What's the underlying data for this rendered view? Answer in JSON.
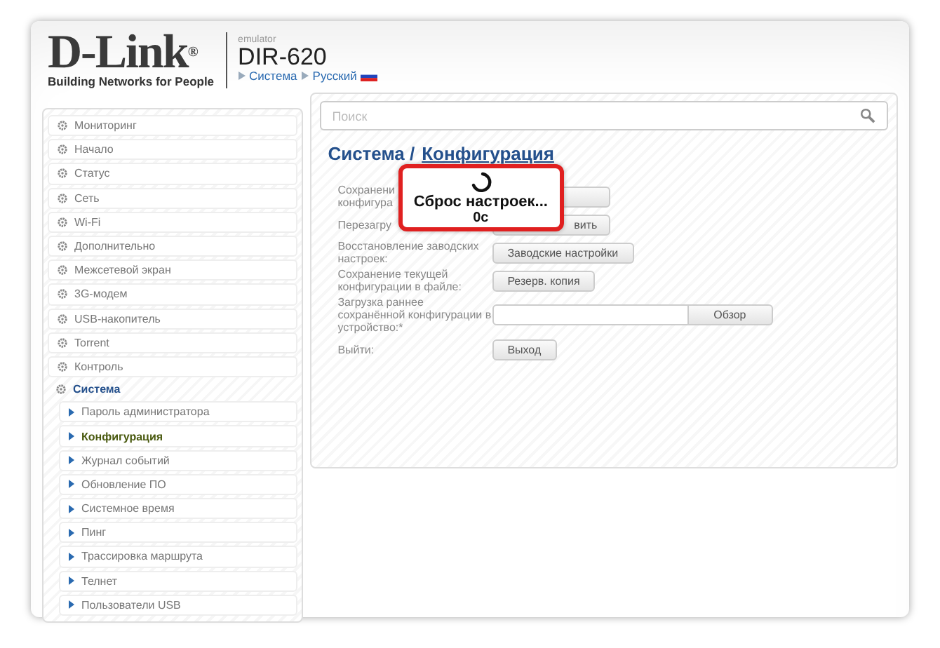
{
  "header": {
    "logo": "D-Link",
    "logo_trademark": "®",
    "tagline": "Building Networks for People",
    "emulator": "emulator",
    "model": "DIR-620",
    "breadcrumb": [
      {
        "label": "Система"
      },
      {
        "label": "Русский"
      }
    ]
  },
  "sidebar": {
    "items": [
      {
        "label": "Мониторинг",
        "expanded": false
      },
      {
        "label": "Начало",
        "expanded": false
      },
      {
        "label": "Статус",
        "expanded": false
      },
      {
        "label": "Сеть",
        "expanded": false
      },
      {
        "label": "Wi-Fi",
        "expanded": false
      },
      {
        "label": "Дополнительно",
        "expanded": false
      },
      {
        "label": "Межсетевой экран",
        "expanded": false
      },
      {
        "label": "3G-модем",
        "expanded": false
      },
      {
        "label": "USB-накопитель",
        "expanded": false
      },
      {
        "label": "Torrent",
        "expanded": false
      },
      {
        "label": "Контроль",
        "expanded": false
      },
      {
        "label": "Система",
        "expanded": true,
        "children": [
          {
            "label": "Пароль администратора",
            "selected": false
          },
          {
            "label": "Конфигурация",
            "selected": true
          },
          {
            "label": "Журнал событий",
            "selected": false
          },
          {
            "label": "Обновление ПО",
            "selected": false
          },
          {
            "label": "Системное время",
            "selected": false
          },
          {
            "label": "Пинг",
            "selected": false
          },
          {
            "label": "Трассировка маршрута",
            "selected": false
          },
          {
            "label": "Телнет",
            "selected": false
          },
          {
            "label": "Пользователи USB",
            "selected": false
          }
        ]
      }
    ]
  },
  "search": {
    "placeholder": "Поиск"
  },
  "page_title": {
    "section": "Система /",
    "page": "Конфигурация"
  },
  "form": {
    "rows": [
      {
        "label": "Сохранени",
        "label_2": "конфигура",
        "kind": "covered_button"
      },
      {
        "label": "Перезагру",
        "kind": "covered_button",
        "button": "вить"
      },
      {
        "label": "Восстановление заводских настроек:",
        "kind": "button",
        "button": "Заводские настройки"
      },
      {
        "label": "Сохранение текущей конфигурации в файле:",
        "kind": "button",
        "button": "Резерв. копия"
      },
      {
        "label": "Загрузка раннее сохранённой конфигурации в устройство:*",
        "kind": "file",
        "button": "Обзор"
      },
      {
        "label": "Выйти:",
        "kind": "button",
        "button": "Выход"
      }
    ]
  },
  "overlay": {
    "message": "Сброс настроек...",
    "timer": "0с"
  }
}
